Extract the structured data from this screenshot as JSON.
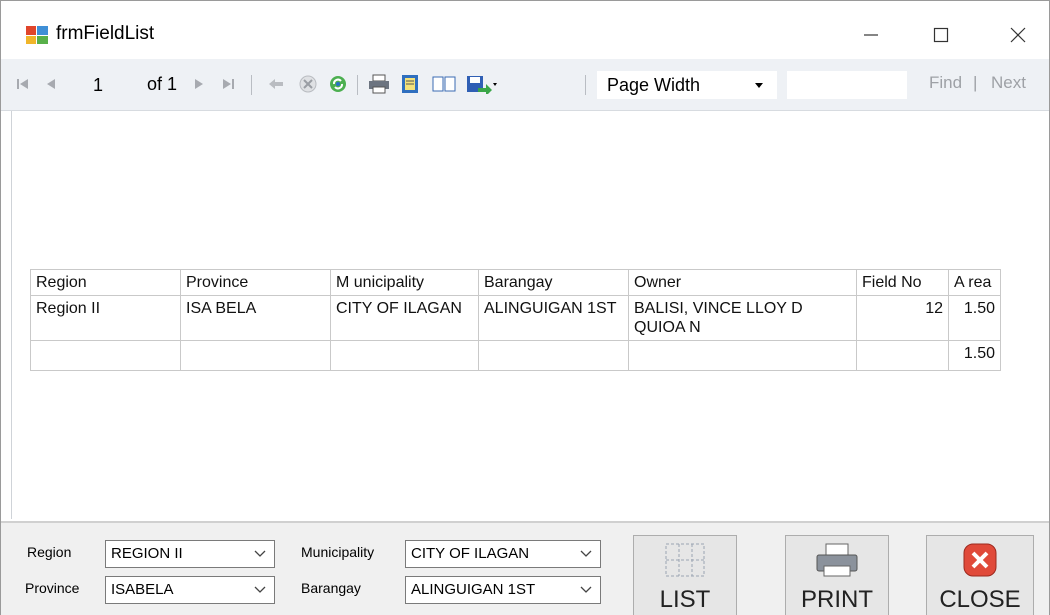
{
  "window": {
    "title": "frmFieldList"
  },
  "toolbar": {
    "page": "1",
    "of_label": "of 1",
    "zoom": "Page Width",
    "find_label": "Find",
    "separator": "|",
    "next_label": "Next"
  },
  "report": {
    "columns": [
      "Region",
      "Province",
      "M unicipality",
      "Barangay",
      "Owner",
      "Field No",
      "A rea"
    ],
    "rows": [
      [
        "Region II",
        "ISA BELA",
        "CITY  OF ILAGAN",
        "ALINGUIGAN 1ST",
        "BALISI, VINCE LLOY D QUIOA N",
        "12",
        "1.50"
      ]
    ],
    "total": "1.50"
  },
  "filters": {
    "region_label": "Region",
    "region_value": "REGION II",
    "province_label": "Province",
    "province_value": "ISABELA",
    "municipality_label": "Municipality",
    "municipality_value": "CITY OF ILAGAN",
    "barangay_label": "Barangay",
    "barangay_value": "ALINGUIGAN 1ST"
  },
  "buttons": {
    "list": "LIST",
    "print": "PRINT",
    "close": "CLOSE"
  },
  "colors": {
    "close_red": "#e04a3a",
    "toolbar_bg": "#eef1f5"
  }
}
